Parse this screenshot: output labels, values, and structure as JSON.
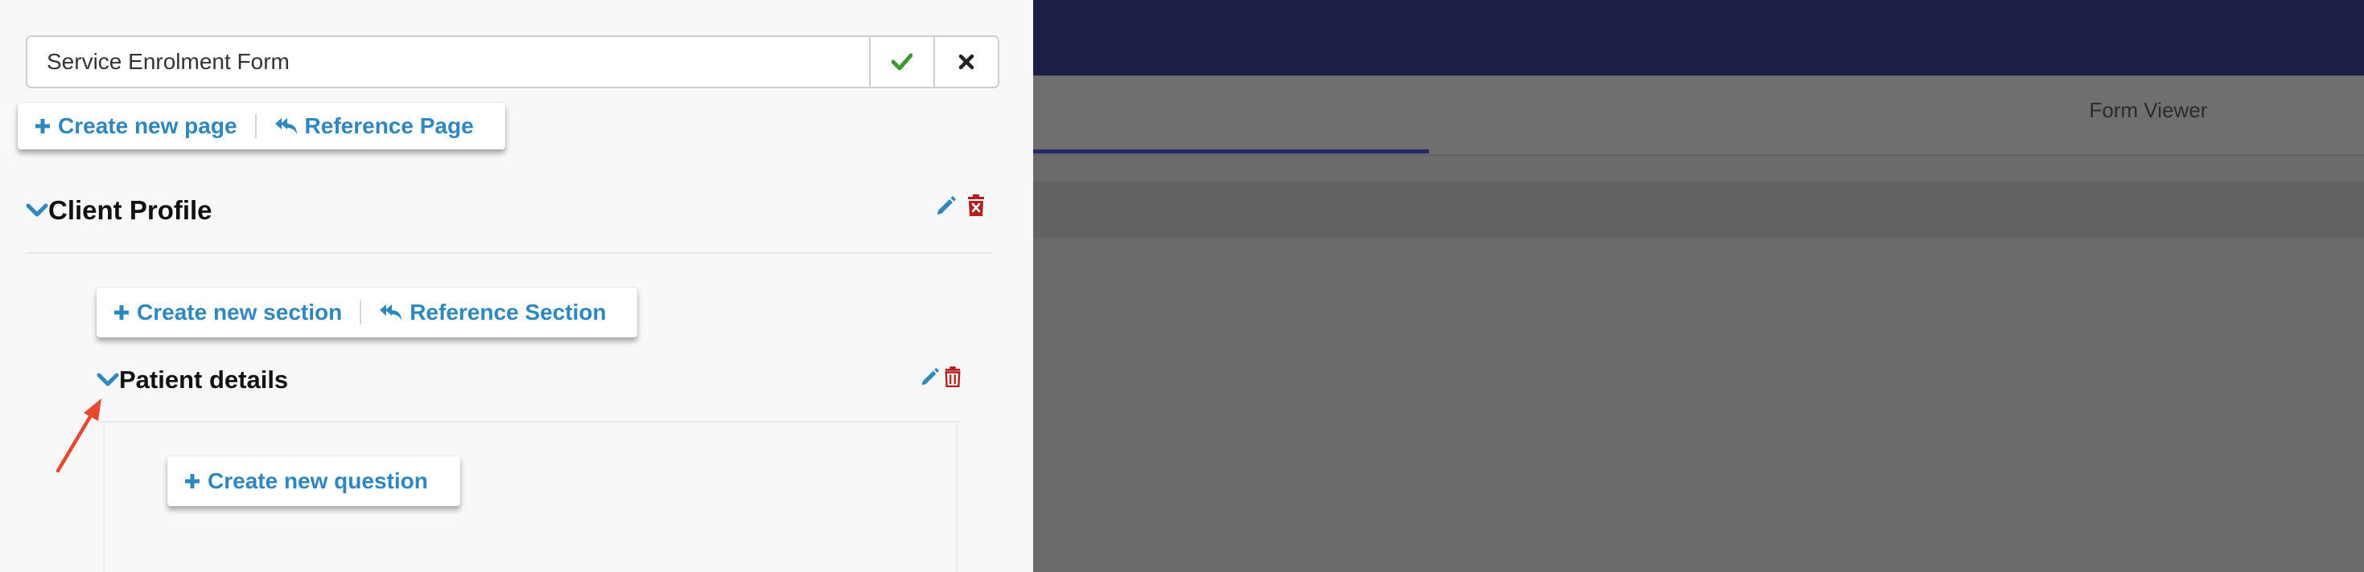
{
  "form": {
    "title_value": "Service Enrolment Form",
    "confirm_icon": "check-icon",
    "cancel_icon": "close-icon"
  },
  "page_toolbar": {
    "create_label": "Create new page",
    "reference_label": "Reference Page"
  },
  "page": {
    "title": "Client Profile",
    "edit_icon": "pencil-icon",
    "delete_icon": "trash-icon"
  },
  "section_toolbar": {
    "create_label": "Create new section",
    "reference_label": "Reference Section"
  },
  "section": {
    "title": "Patient details",
    "edit_icon": "pencil-icon",
    "delete_icon": "trash-icon"
  },
  "question_toolbar": {
    "create_label": "Create new question"
  },
  "background": {
    "tab_form_viewer": "Form Viewer"
  },
  "colors": {
    "accent_blue": "#2f87bd",
    "confirm_green": "#3a9a2e",
    "delete_red": "#b31f1f",
    "annotation_arrow": "#e8482f",
    "navbar": "#1c2048"
  }
}
